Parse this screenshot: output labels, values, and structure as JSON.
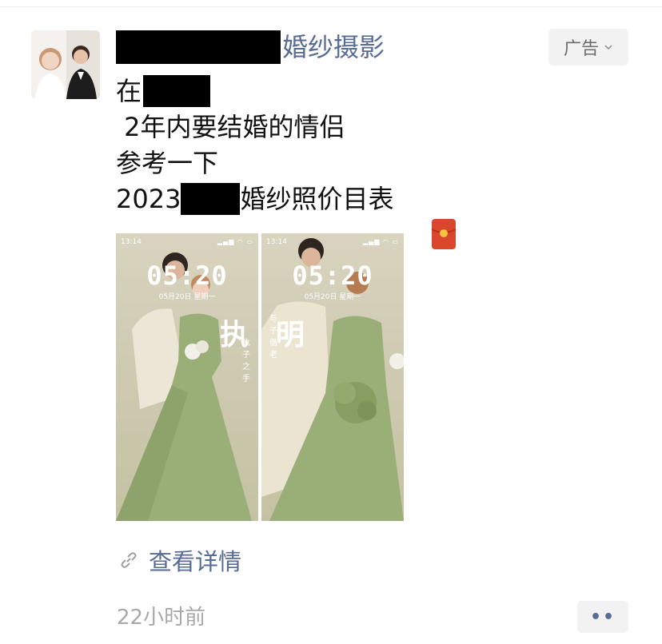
{
  "post": {
    "author_name_suffix": "婚纱摄影",
    "ad_label": "广告",
    "line1_prefix": "在",
    "line2": " 2年内要结婚的情侣",
    "line3": "参考一下",
    "line4_prefix": "2023",
    "line4_suffix": "婚纱照价目表",
    "link_text": "查看详情",
    "time_ago": "22小时前",
    "more_glyph": "••"
  },
  "photos": [
    {
      "status_time": "13:14",
      "clock": "05:20",
      "date": "05月20日 星期一",
      "calligraphy": "执",
      "vertical_text": "执子之手"
    },
    {
      "status_time": "13:14",
      "clock": "05:20",
      "date": "05月20日 星期一",
      "calligraphy": "明",
      "vertical_text": "与子偕老"
    }
  ],
  "colors": {
    "link": "#576b95",
    "dress_green": "#9aae78",
    "envelope_red": "#d9462b"
  },
  "icons": {
    "ad_chevron": "chevron-down-icon",
    "link": "link-icon",
    "envelope": "red-envelope-icon"
  }
}
